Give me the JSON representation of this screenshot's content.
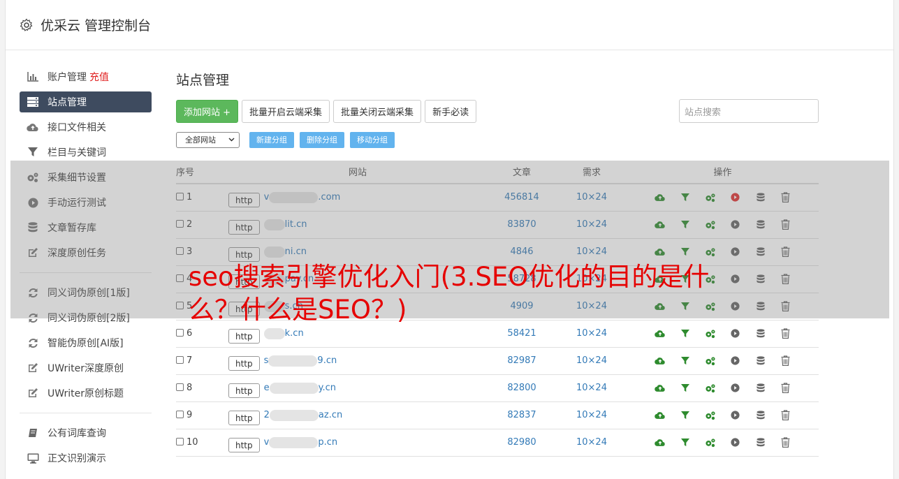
{
  "header": {
    "title": "优采云 管理控制台",
    "icon": "gear-icon"
  },
  "sidebar": {
    "account": {
      "label": "账户管理",
      "recharge": "充值"
    },
    "items": [
      {
        "label": "站点管理",
        "icon": "server-icon",
        "active": true
      },
      {
        "label": "接口文件相关",
        "icon": "cloud-upload-icon"
      },
      {
        "label": "栏目与关键词",
        "icon": "filter-icon"
      },
      {
        "label": "采集细节设置",
        "icon": "gears-icon"
      },
      {
        "label": "手动运行测试",
        "icon": "play-circle-icon"
      },
      {
        "label": "文章暂存库",
        "icon": "database-icon"
      },
      {
        "label": "深度原创任务",
        "icon": "edit-icon"
      }
    ],
    "items2": [
      {
        "label": "同义词伪原创[1版]",
        "icon": "refresh-icon"
      },
      {
        "label": "同义词伪原创[2版]",
        "icon": "refresh-icon"
      },
      {
        "label": "智能伪原创[AI版]",
        "icon": "refresh-icon"
      },
      {
        "label": "UWriter深度原创",
        "icon": "edit-icon"
      },
      {
        "label": "UWriter原创标题",
        "icon": "edit-icon"
      }
    ],
    "items3": [
      {
        "label": "公有词库查询",
        "icon": "book-icon"
      },
      {
        "label": "正文识别演示",
        "icon": "monitor-icon"
      }
    ]
  },
  "main": {
    "title": "站点管理",
    "buttons": {
      "add": "添加网站 +",
      "enable": "批量开启云端采集",
      "disable": "批量关闭云端采集",
      "guide": "新手必读"
    },
    "search_placeholder": "站点搜索",
    "group_select": "全部网站",
    "group_buttons": {
      "new": "新建分组",
      "delete": "删除分组",
      "move": "移动分组"
    },
    "table": {
      "headers": {
        "no": "序号",
        "site": "网站",
        "articles": "文章",
        "demand": "需求",
        "ops": "操作"
      },
      "http": "http",
      "rows": [
        {
          "no": "1",
          "site_pre": "v",
          "site": ".com",
          "articles": "456814",
          "demand": "10×24",
          "running": true
        },
        {
          "no": "2",
          "site_pre": "",
          "site": "lit.cn",
          "articles": "83870",
          "demand": "10×24",
          "running": false
        },
        {
          "no": "3",
          "site_pre": "",
          "site": "ni.cn",
          "articles": "4846",
          "demand": "10×24",
          "running": false
        },
        {
          "no": "4",
          "site_pre": "",
          "site": "pay.cn",
          "articles": "58728",
          "demand": "10×24",
          "running": false
        },
        {
          "no": "5",
          "site_pre": "",
          "site": "s.cn",
          "articles": "4909",
          "demand": "10×24",
          "running": false
        },
        {
          "no": "6",
          "site_pre": "",
          "site": "k.cn",
          "articles": "58421",
          "demand": "10×24",
          "running": false
        },
        {
          "no": "7",
          "site_pre": "s",
          "site": "9.cn",
          "articles": "82987",
          "demand": "10×24",
          "running": false
        },
        {
          "no": "8",
          "site_pre": "e",
          "site": "y.cn",
          "articles": "82800",
          "demand": "10×24",
          "running": false
        },
        {
          "no": "9",
          "site_pre": "2",
          "site": "az.cn",
          "articles": "82837",
          "demand": "10×24",
          "running": false
        },
        {
          "no": "10",
          "site_pre": "v",
          "site": "p.cn",
          "articles": "82980",
          "demand": "10×24",
          "running": false
        }
      ]
    }
  },
  "overlay": {
    "text": "seo搜索引擎优化入门(3.SEO优化的目的是什么？什么是SEO？)",
    "color": "#e60000"
  }
}
